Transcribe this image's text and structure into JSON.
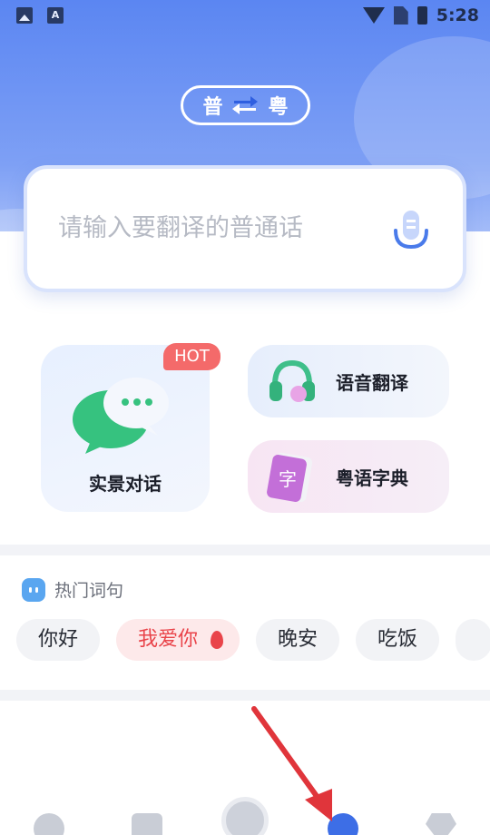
{
  "status_bar": {
    "time": "5:28",
    "left_icons": [
      "image-icon",
      "a-icon"
    ],
    "right_icons": [
      "wifi-icon",
      "no-sim-icon",
      "battery-icon"
    ]
  },
  "lang_toggle": {
    "source": "普",
    "target": "粤"
  },
  "input": {
    "placeholder": "请输入要翻译的普通话"
  },
  "features": {
    "scene_dialog": {
      "label": "实景对话",
      "badge": "HOT"
    },
    "voice_translate": {
      "label": "语音翻译"
    },
    "cantonese_dict": {
      "label": "粤语字典",
      "icon_char": "字"
    }
  },
  "hot_phrases": {
    "title": "热门词句",
    "chips": [
      "你好",
      "我爱你",
      "晚安",
      "吃饭"
    ]
  },
  "colors": {
    "accent": "#3d6ee6",
    "hot": "#f46a6a",
    "annotation_arrow": "#e0353b"
  }
}
